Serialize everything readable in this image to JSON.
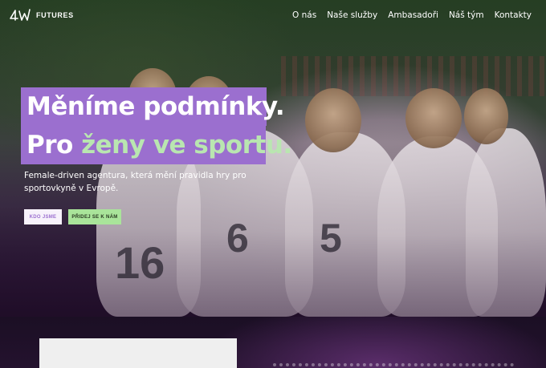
{
  "brand": {
    "name": "FUTURES",
    "logo_icon": "4w-logo-icon"
  },
  "nav": {
    "items": [
      {
        "label": "O nás"
      },
      {
        "label": "Naše služby"
      },
      {
        "label": "Ambasadoři"
      },
      {
        "label": "Náš tým"
      },
      {
        "label": "Kontakty"
      }
    ]
  },
  "hero": {
    "headline_line1": "Měníme  podmínky.",
    "headline_line2_prefix": "Pro ",
    "headline_line2_accent": "ženy ve sportu.",
    "subtitle": "Female-driven agentura, která mění pravidla hry pro sportovkyně v Evropě.",
    "buttons": {
      "who_label": "KDO JSME",
      "join_label": "PŘIDEJ SE K NÁM"
    },
    "jersey_numbers": [
      "16",
      "6",
      "5"
    ]
  },
  "colors": {
    "accent_purple": "#9b6fcf",
    "accent_green": "#b9e6b0",
    "join_button": "#a9e49a",
    "dark_bg": "#1b0f24"
  }
}
